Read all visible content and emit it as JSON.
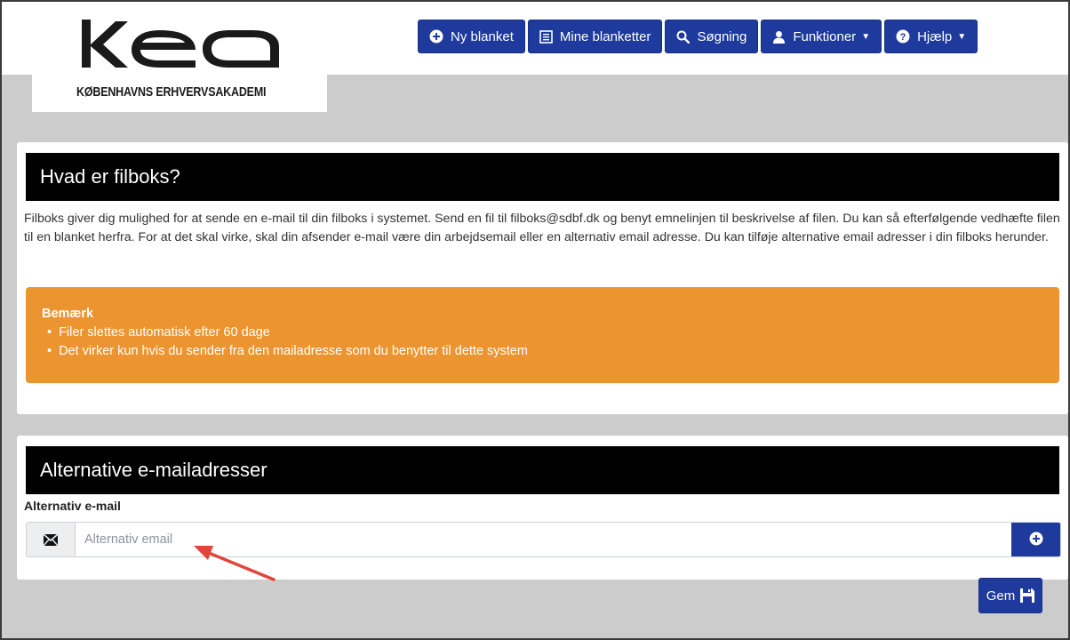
{
  "logo": {
    "mark": "kea",
    "subtitle": "KØBENHAVNS ERHVERVSAKADEMI"
  },
  "nav": {
    "new_form": "Ny blanket",
    "my_forms": "Mine blanketter",
    "search": "Søgning",
    "functions": "Funktioner",
    "help": "Hjælp"
  },
  "intro_panel": {
    "heading": "Hvad er filboks?",
    "text": "Filboks giver dig mulighed for at sende en e-mail til din filboks i systemet. Send en fil til filboks@sdbf.dk og benyt emnelinjen til beskrivelse af filen. Du kan så efterfølgende vedhæfte filen til en blanket herfra. For at det skal virke, skal din afsender e-mail være din arbejdsemail eller en alternativ email adresse. Du kan tilføje alternative email adresser i din filboks herunder.",
    "alert": {
      "title": "Bemærk",
      "items": [
        "Filer slettes automatisk efter 60 dage",
        "Det virker kun hvis du sender fra den mailadresse som du benytter til dette system"
      ]
    }
  },
  "email_panel": {
    "heading": "Alternative e-mailadresser",
    "field_label": "Alternativ e-mail",
    "input_value": "",
    "input_placeholder": "Alternativ email"
  },
  "save_label": "Gem",
  "colors": {
    "primary": "#1e3a9c",
    "warning": "#ec942f",
    "header": "#000000",
    "annotation_arrow": "#e0463a"
  },
  "icons": [
    "plus-circle-icon",
    "list-icon",
    "search-icon",
    "user-icon",
    "question-circle-icon",
    "envelope-icon",
    "floppy-disk-icon"
  ]
}
